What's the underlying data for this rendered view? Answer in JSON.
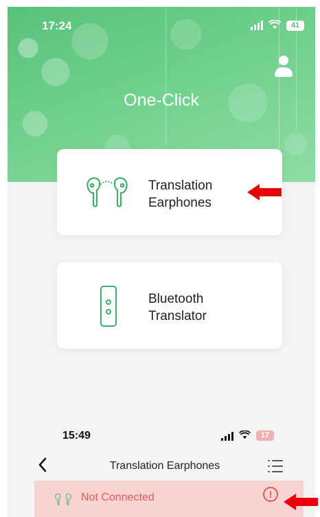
{
  "top_screen": {
    "status_bar": {
      "time": "17:24",
      "battery": "41"
    },
    "title": "One-Click",
    "cards": [
      {
        "label": "Translation\nEarphones",
        "icon": "earbuds-icon"
      },
      {
        "label": "Bluetooth\nTranslator",
        "icon": "translator-device-icon"
      }
    ]
  },
  "bottom_screen": {
    "status_bar": {
      "time": "15:49",
      "battery": "17"
    },
    "nav": {
      "back_icon": "chevron-left-icon",
      "title": "Translation Earphones",
      "menu_icon": "list-menu-icon"
    },
    "connection": {
      "status": "Not Connected",
      "icon": "earbuds-icon",
      "alert_icon": "alert-circle-icon"
    }
  },
  "colors": {
    "accent_green": "#58c27a",
    "alert_red": "#e15a57",
    "annotation_red": "#e8000b",
    "banner_pink": "#f7d3d2"
  }
}
